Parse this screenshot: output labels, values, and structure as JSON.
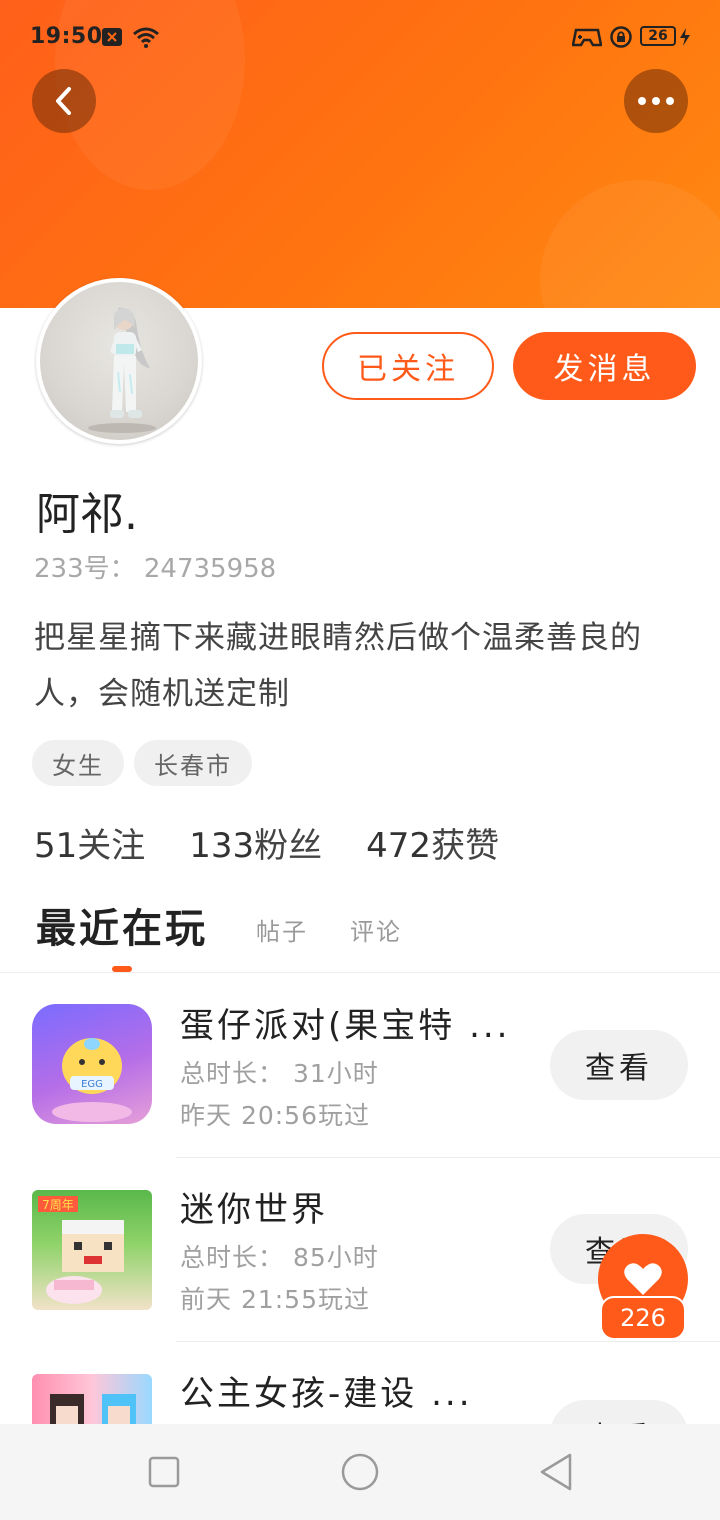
{
  "status_bar": {
    "time": "19:50",
    "battery": "26",
    "icons": [
      "notification-x-icon",
      "wifi-icon",
      "gamepad-icon",
      "lock-icon",
      "battery-icon",
      "charging-icon"
    ]
  },
  "header": {
    "back_icon": "chevron-left-icon",
    "more_icon": "more-dots-icon",
    "banner_color": "#ff6a14"
  },
  "profile": {
    "name": "阿祁.",
    "id_line": "233号： 24735958",
    "bio": "把星星摘下来藏进眼睛然后做个温柔善良的人，会随机送定制",
    "tags": [
      "女生",
      "长春市"
    ],
    "followed_label": "已关注",
    "message_label": "发消息"
  },
  "stats": [
    {
      "num": "51",
      "label": "关注"
    },
    {
      "num": "133",
      "label": "粉丝"
    },
    {
      "num": "472",
      "label": "获赞"
    }
  ],
  "tabs": {
    "active": "最近在玩",
    "others": [
      "帖子",
      "评论"
    ]
  },
  "games": [
    {
      "title": "蛋仔派对(果宝特 ...",
      "duration": "总时长： 31小时",
      "last_played": "昨天 20:56玩过",
      "button": "查看"
    },
    {
      "title": "迷你世界",
      "duration": "总时长： 85小时",
      "last_played": "前天 21:55玩过",
      "button": "查看"
    },
    {
      "title": "公主女孩-建设 ...",
      "duration": "",
      "last_played": "",
      "button": "查看"
    }
  ],
  "like_fab": {
    "count": "226",
    "icon": "heart-icon"
  },
  "colors": {
    "accent": "#ff5a1a",
    "tag_bg": "#f0f0f0",
    "button_bg": "#f1f1f1"
  },
  "nav_bar": {
    "icons": [
      "recents-square-icon",
      "home-circle-icon",
      "back-triangle-icon"
    ]
  }
}
